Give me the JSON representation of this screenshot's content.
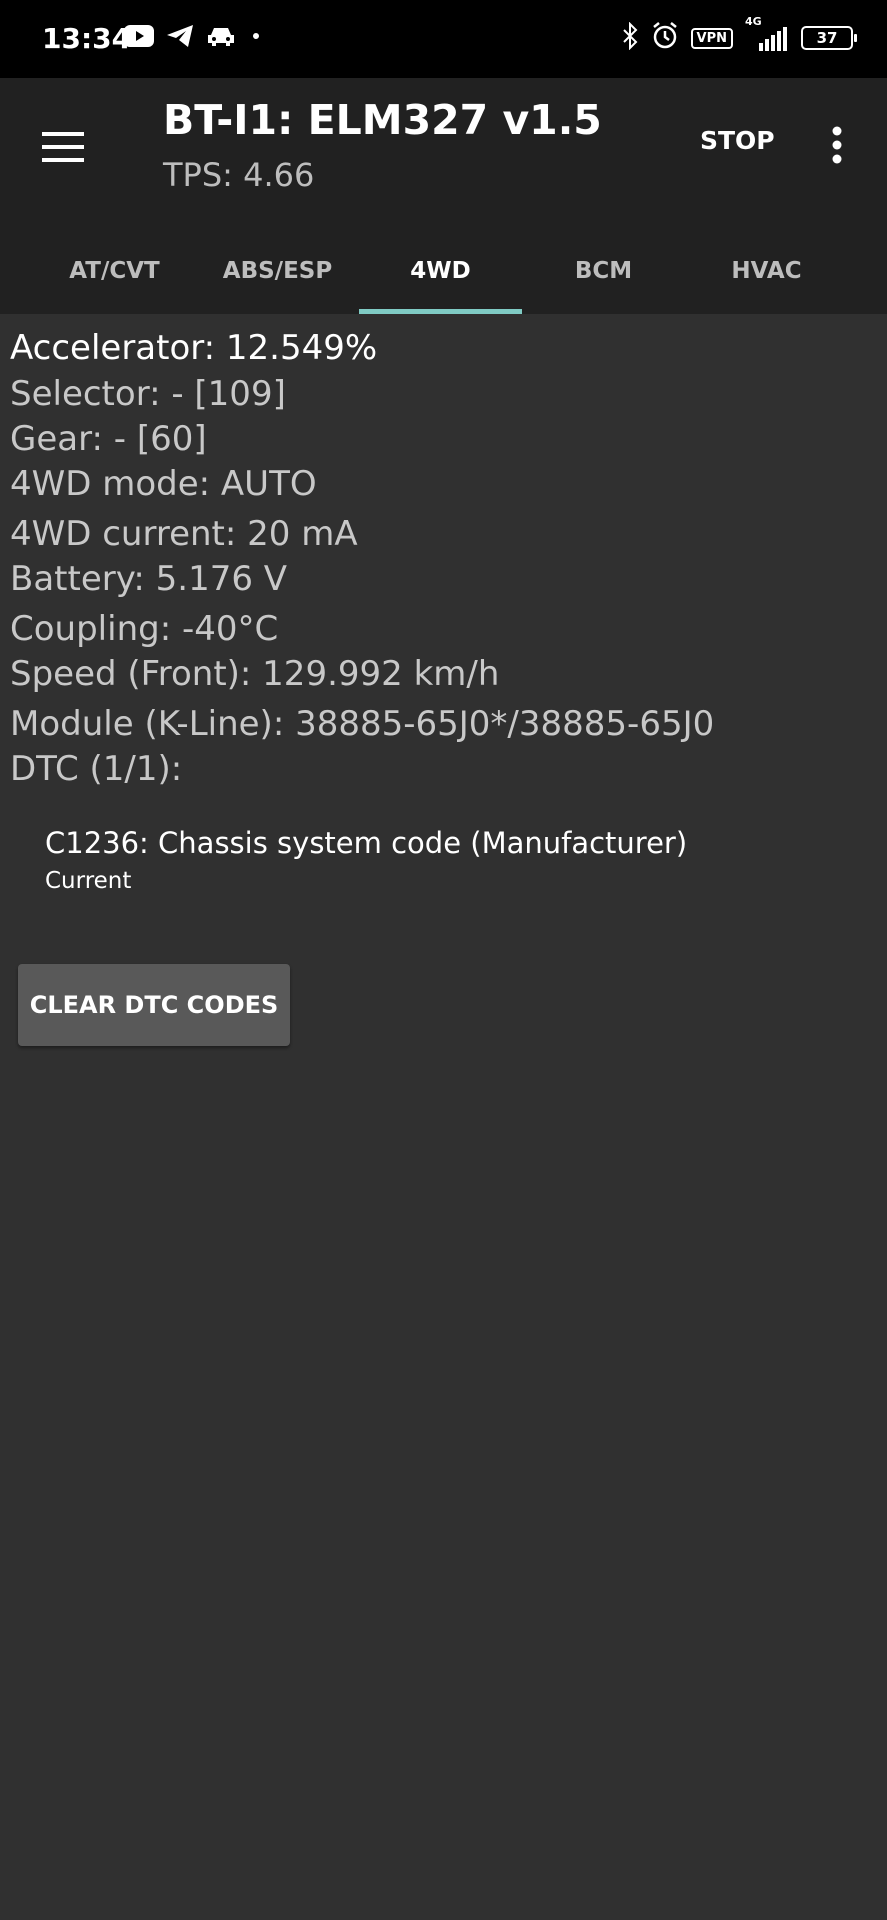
{
  "status_bar": {
    "time": "13:34",
    "left_icons": [
      "youtube-icon",
      "telegram-icon",
      "car-icon",
      "dot-icon"
    ],
    "vpn": "VPN",
    "network": "4G",
    "battery": "37"
  },
  "app_bar": {
    "title": "BT-I1: ELM327 v1.5",
    "subtitle": "TPS: 4.66",
    "stop_label": "STOP"
  },
  "tabs": [
    {
      "label": "AT/CVT",
      "active": false
    },
    {
      "label": "ABS/ESP",
      "active": false
    },
    {
      "label": "4WD",
      "active": true
    },
    {
      "label": "BCM",
      "active": false
    },
    {
      "label": "HVAC",
      "active": false
    }
  ],
  "params": [
    "Accelerator: 12.549%",
    "Selector: - [109]",
    "Gear: - [60]",
    "4WD mode: AUTO",
    "4WD current: 20 mA",
    "Battery: 5.176 V",
    "Coupling: -40°C",
    "Speed (Front): 129.992 km/h",
    "Module (K-Line): 38885-65J0*/38885-65J0",
    "DTC (1/1):"
  ],
  "dtc": {
    "code_description": "C1236: Chassis system code (Manufacturer)",
    "status": "Current"
  },
  "clear_button_label": "CLEAR DTC CODES",
  "colors": {
    "background": "#303030",
    "app_bar": "#212121",
    "tab_indicator": "#80cbc4",
    "button": "#595959"
  }
}
